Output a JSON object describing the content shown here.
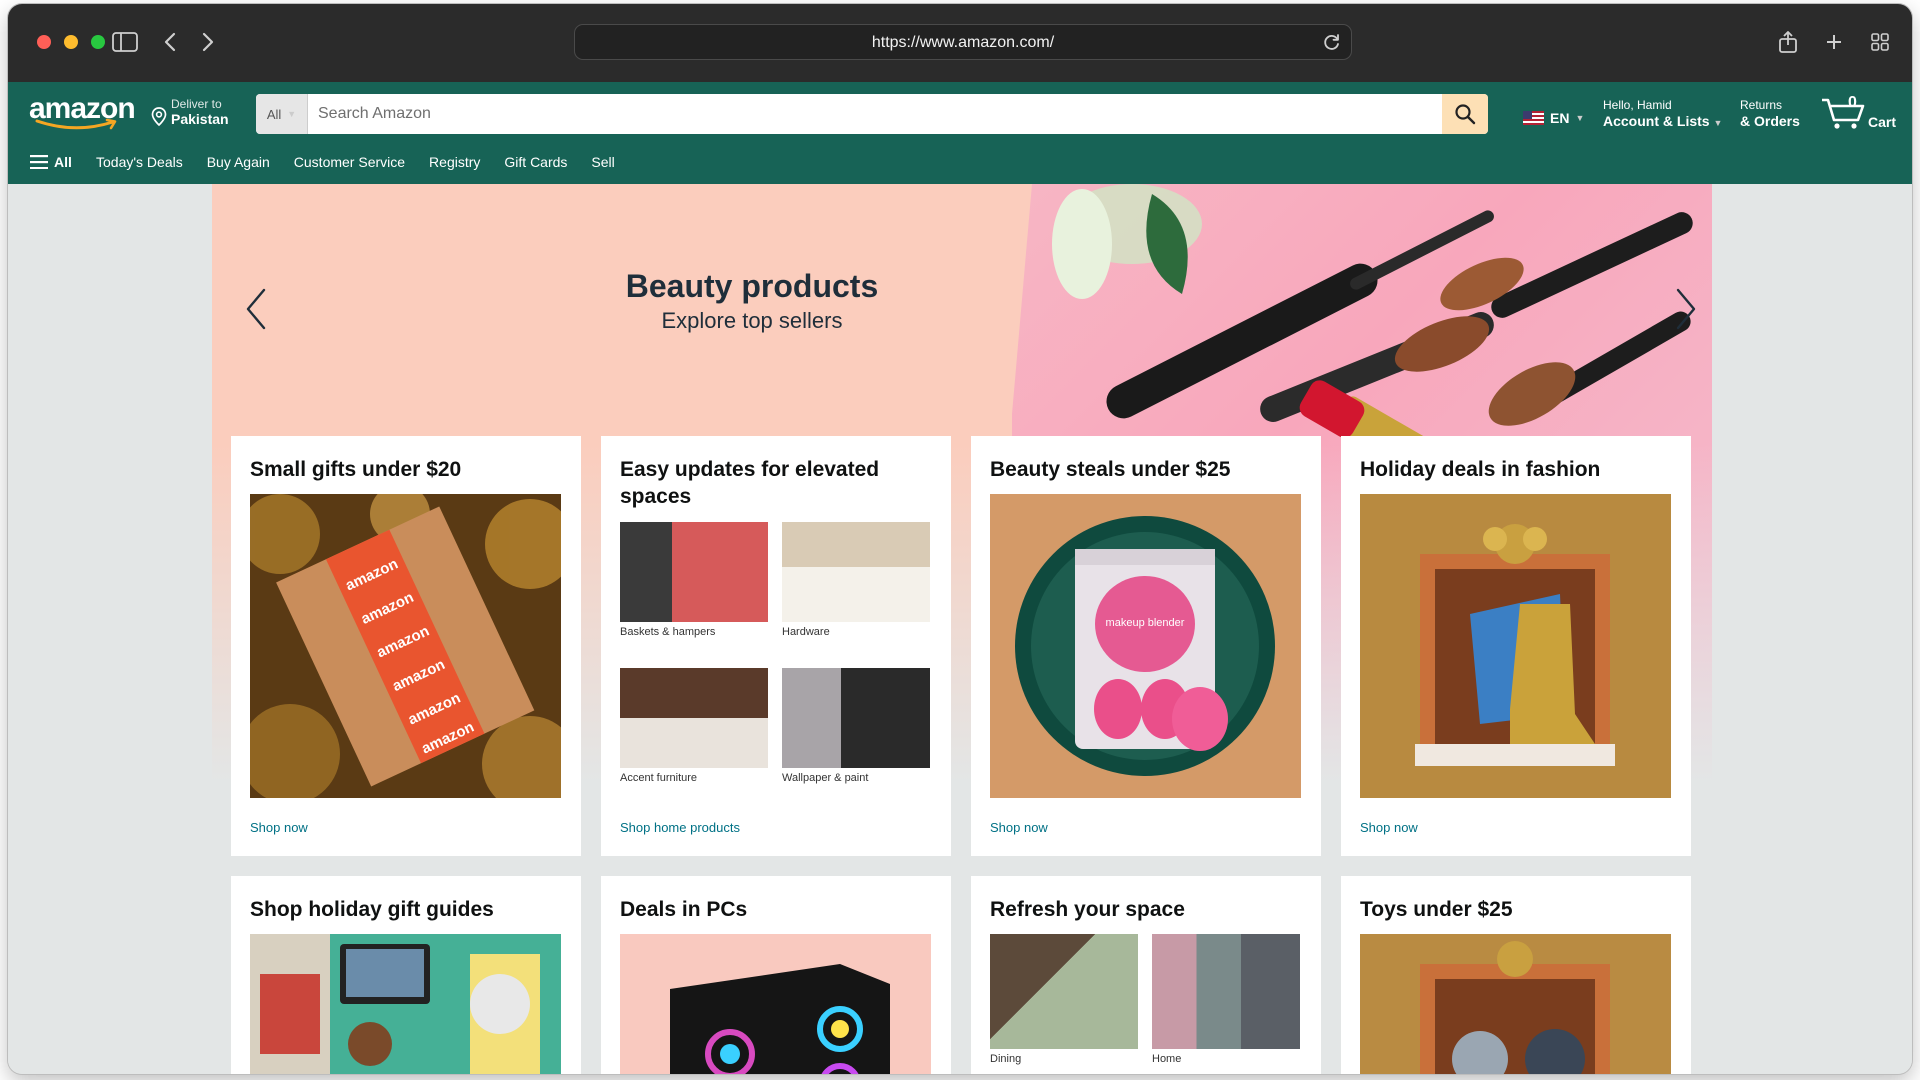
{
  "browser": {
    "url": "https://www.amazon.com/"
  },
  "header": {
    "logo": "amazon",
    "deliver_label": "Deliver to",
    "deliver_location": "Pakistan",
    "search_category": "All",
    "search_placeholder": "Search Amazon",
    "language": "EN",
    "account_greeting": "Hello, Hamid",
    "account_label": "Account & Lists",
    "returns_label": "Returns",
    "orders_label": "& Orders",
    "cart_count": "0",
    "cart_label": "Cart"
  },
  "subnav": {
    "all_label": "All",
    "links": [
      "Today's Deals",
      "Buy Again",
      "Customer Service",
      "Registry",
      "Gift Cards",
      "Sell"
    ]
  },
  "hero": {
    "title": "Beauty products",
    "subtitle": "Explore top sellers"
  },
  "cards": [
    {
      "title": "Small gifts under $20",
      "link": "Shop now",
      "image": "amazon-box-on-tinsel"
    },
    {
      "title": "Easy updates for elevated spaces",
      "link": "Shop home products",
      "items": [
        "Baskets & hampers",
        "Hardware",
        "Accent furniture",
        "Wallpaper & paint"
      ]
    },
    {
      "title": "Beauty steals under $25",
      "link": "Shop now",
      "image": "makeup-blender",
      "image_text": "makeup blender"
    },
    {
      "title": "Holiday deals in fashion",
      "link": "Shop now",
      "image": "boots-in-gift-box"
    },
    {
      "title": "Shop holiday gift guides",
      "image": "gift-guides-collage"
    },
    {
      "title": "Deals in PCs",
      "image": "gaming-pc"
    },
    {
      "title": "Refresh your space",
      "items": [
        "Dining",
        "Home"
      ]
    },
    {
      "title": "Toys under $25",
      "image": "plush-toys-box"
    }
  ],
  "colors": {
    "nav_bg": "#176356",
    "hero_bg": "#fbcdbd",
    "link": "#007185",
    "search_button": "#fde0b5"
  }
}
